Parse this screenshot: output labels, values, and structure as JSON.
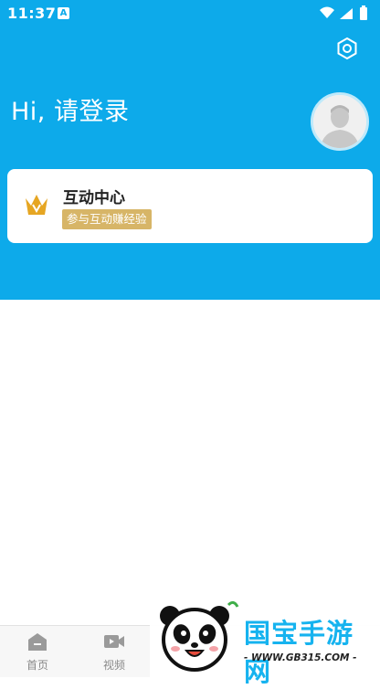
{
  "status_bar": {
    "time": "11:37",
    "notification_icon": "A"
  },
  "header": {
    "greeting": "Hi, 请登录",
    "settings_icon": "gear-icon",
    "avatar_icon": "default-avatar"
  },
  "interaction_card": {
    "title": "互动中心",
    "badge": "参与互动赚经验",
    "icon": "crown-icon"
  },
  "tabbar": {
    "items": [
      {
        "label": "首页",
        "icon": "home-icon"
      },
      {
        "label": "视频",
        "icon": "video-icon"
      }
    ]
  },
  "watermark": {
    "brand": "国宝手游网",
    "url": "- WWW.GB315.COM -"
  },
  "colors": {
    "header_bg": "#0daaea",
    "badge_bg": "#d7b567",
    "crown": "#e6a623"
  }
}
